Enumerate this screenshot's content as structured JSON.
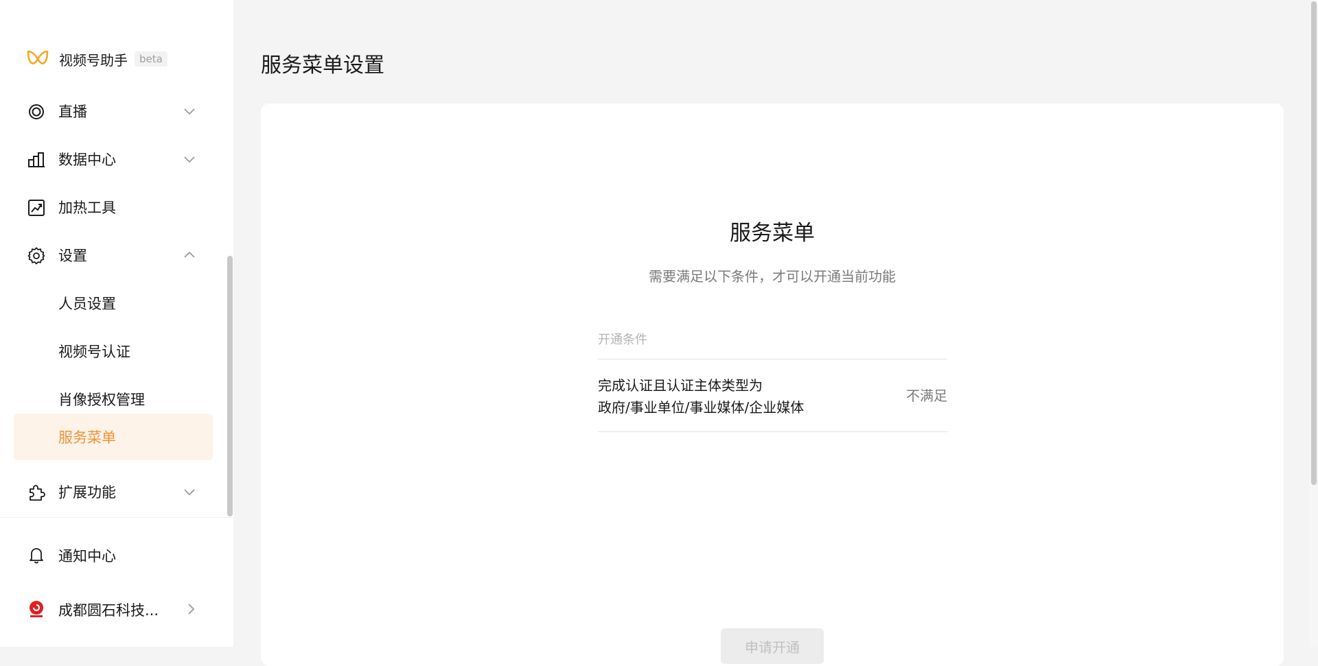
{
  "brand": {
    "name": "视频号助手",
    "badge": "beta"
  },
  "sidebar": {
    "items": [
      {
        "label": "直播",
        "icon": "live-icon",
        "expandable": true,
        "expanded": false
      },
      {
        "label": "数据中心",
        "icon": "bar-chart-icon",
        "expandable": true,
        "expanded": false
      },
      {
        "label": "加热工具",
        "icon": "trend-icon",
        "expandable": false
      },
      {
        "label": "设置",
        "icon": "gear-icon",
        "expandable": true,
        "expanded": true
      },
      {
        "label": "人员设置",
        "sub": true
      },
      {
        "label": "视频号认证",
        "sub": true
      },
      {
        "label": "肖像授权管理",
        "sub": true
      },
      {
        "label": "服务菜单",
        "sub": true,
        "active": true
      },
      {
        "label": "扩展功能",
        "icon": "puzzle-icon",
        "expandable": true,
        "expanded": false
      }
    ],
    "bottom": {
      "notification_label": "通知中心",
      "account_label": "成都圆石科技..."
    }
  },
  "page": {
    "title": "服务菜单设置"
  },
  "card": {
    "title": "服务菜单",
    "description": "需要满足以下条件，才可以开通当前功能",
    "conditions_header": "开通条件",
    "conditions": [
      {
        "line1": "完成认证且认证主体类型为",
        "line2": "政府/事业单位/事业媒体/企业媒体",
        "status": "不满足"
      }
    ],
    "apply_label": "申请开通"
  },
  "colors": {
    "accent": "#f0923a",
    "active_bg": "#fdf3e8",
    "brand_logo": "#f5a623"
  }
}
